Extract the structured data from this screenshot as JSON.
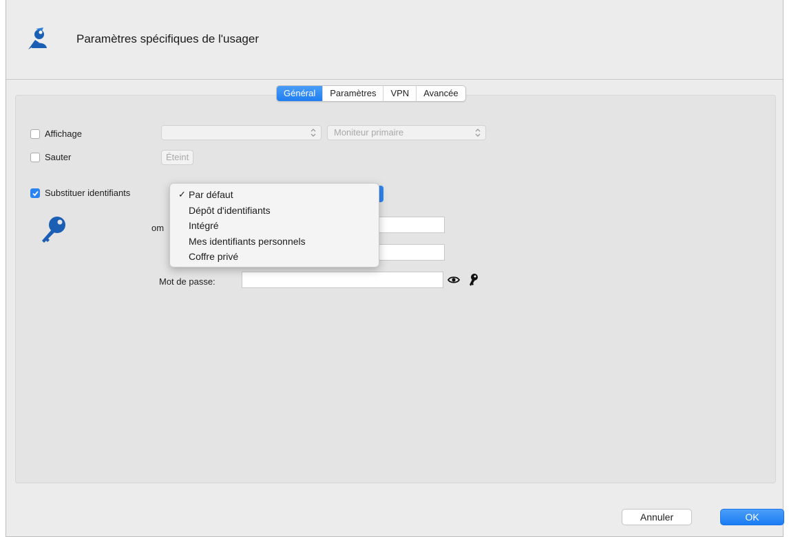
{
  "window": {
    "title": "Paramètres spécifiques de l'usager",
    "accent_color": "#1f7ef2"
  },
  "tabs": [
    {
      "label": "Général",
      "active": true
    },
    {
      "label": "Paramètres",
      "active": false
    },
    {
      "label": "VPN",
      "active": false
    },
    {
      "label": "Avancée",
      "active": false
    }
  ],
  "display": {
    "checkbox_label": "Affichage",
    "checked": false,
    "select_value": "",
    "monitor_select": "Moniteur primaire"
  },
  "skip": {
    "checkbox_label": "Sauter",
    "checked": false,
    "state_button": "Éteint"
  },
  "credentials": {
    "checkbox_label": "Substituer identifiants",
    "checked": true,
    "dropdown_options": [
      {
        "label": "Par défaut",
        "selected": true
      },
      {
        "label": "Dépôt d'identifiants",
        "selected": false
      },
      {
        "label": "Intégré",
        "selected": false
      },
      {
        "label": "Mes identifiants personnels",
        "selected": false
      },
      {
        "label": "Coffre privé",
        "selected": false
      }
    ],
    "selected_check": "✓",
    "username_label_partial": "om",
    "password_label": "Mot de passe:",
    "username_value": "",
    "domain_value": "",
    "password_value": ""
  },
  "footer": {
    "cancel": "Annuler",
    "ok": "OK"
  }
}
